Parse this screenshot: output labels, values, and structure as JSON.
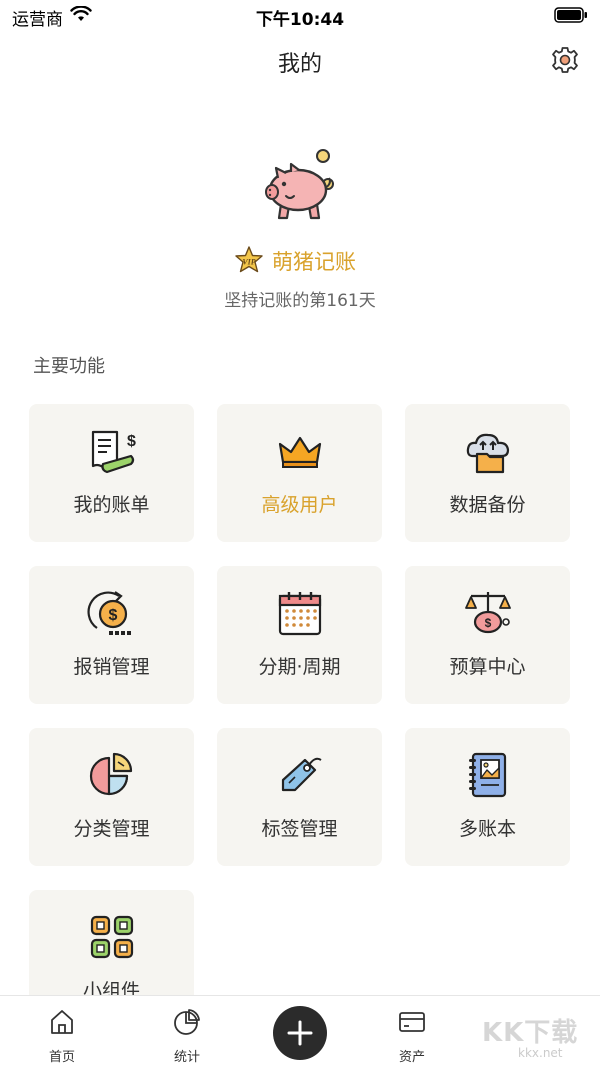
{
  "status_bar": {
    "carrier": "运营商",
    "time": "下午10:44"
  },
  "nav": {
    "title": "我的"
  },
  "profile": {
    "username": "萌猪记账",
    "vip_label": "VIP",
    "streak": "坚持记账的第161天"
  },
  "section": {
    "title": "主要功能"
  },
  "features": [
    {
      "label": "我的账单",
      "icon": "bill-receipt-icon"
    },
    {
      "label": "高级用户",
      "icon": "crown-icon",
      "highlight_color": "#d9a22c"
    },
    {
      "label": "数据备份",
      "icon": "cloud-backup-icon"
    },
    {
      "label": "报销管理",
      "icon": "reimbursement-coin-icon"
    },
    {
      "label": "分期·周期",
      "icon": "calendar-icon"
    },
    {
      "label": "预算中心",
      "icon": "budget-scale-icon"
    },
    {
      "label": "分类管理",
      "icon": "category-pie-icon"
    },
    {
      "label": "标签管理",
      "icon": "tag-icon"
    },
    {
      "label": "多账本",
      "icon": "notebook-icon"
    },
    {
      "label": "小组件",
      "icon": "widget-grid-icon"
    }
  ],
  "tabs": {
    "home": "首页",
    "stats": "统计",
    "assets": "资产"
  },
  "watermark": {
    "main": "KK下载",
    "sub": "kkx.net"
  },
  "colors": {
    "accent_gold": "#d9a22c",
    "card_bg": "#f6f5f1",
    "add_button": "#2b2b2b"
  }
}
